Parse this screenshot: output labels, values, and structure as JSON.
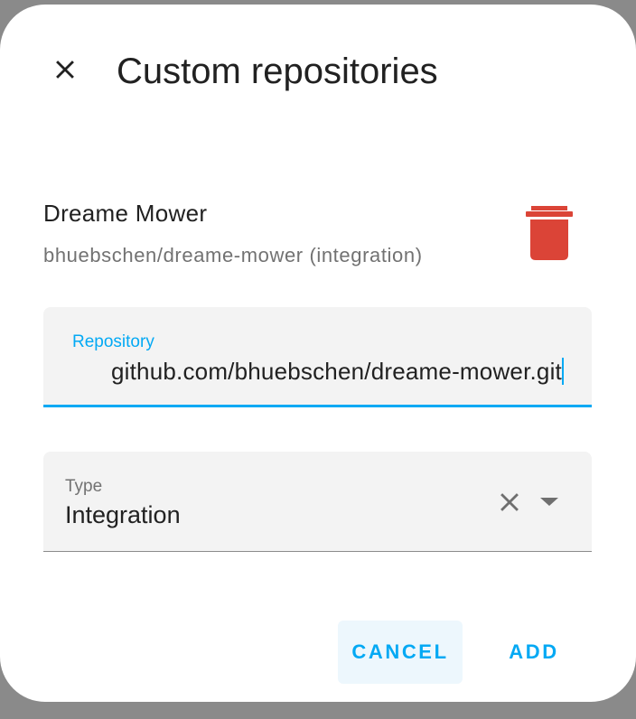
{
  "dialog": {
    "title": "Custom repositories",
    "close_icon": "close-icon"
  },
  "repository_item": {
    "name": "Dreame Mower",
    "subtitle": "bhuebschen/dreame-mower (integration)",
    "delete_icon": "trash-icon",
    "delete_color": "#db4437"
  },
  "repository_field": {
    "label": "Repository",
    "value": "github.com/bhuebschen/dreame-mower.git",
    "accent": "#03a9f4"
  },
  "type_field": {
    "label": "Type",
    "value": "Integration",
    "clear_icon": "clear-icon",
    "dropdown_icon": "dropdown-arrow-icon"
  },
  "actions": {
    "cancel_label": "CANCEL",
    "add_label": "ADD"
  }
}
